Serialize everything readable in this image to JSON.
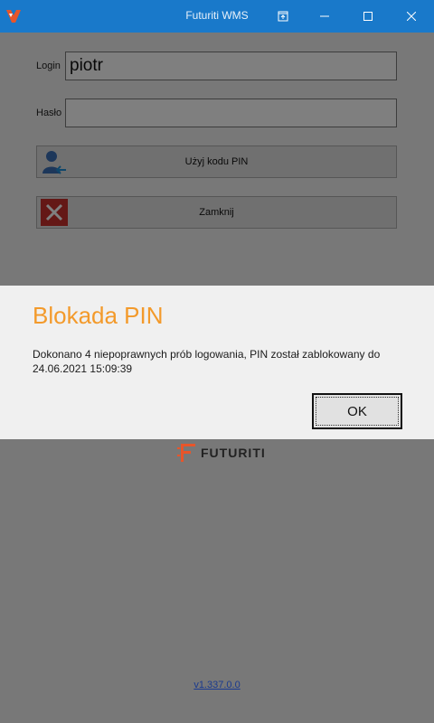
{
  "window": {
    "title": "Futuriti WMS"
  },
  "form": {
    "login_label": "Login",
    "login_value": "piotr",
    "password_label": "Hasło",
    "password_value": "",
    "pin_button_label": "Użyj kodu PIN",
    "close_button_label": "Zamknij"
  },
  "dialog": {
    "title": "Blokada PIN",
    "message": "Dokonano 4 niepoprawnych prób logowania, PIN został zablokowany do 24.06.2021 15:09:39",
    "ok_label": "OK"
  },
  "brand": {
    "text": "FUTURITI"
  },
  "footer": {
    "version": "v1.337.0.0"
  },
  "colors": {
    "titlebar": "#1979ca",
    "dialog_title": "#f39a2b",
    "close_icon_bg": "#c9302c",
    "brand_accent": "#e8552a"
  },
  "icons": [
    "app-logo",
    "restore-down-icon",
    "minimize-icon",
    "maximize-icon",
    "close-icon",
    "user-pin-icon",
    "close-x-icon",
    "futuriti-logo"
  ]
}
